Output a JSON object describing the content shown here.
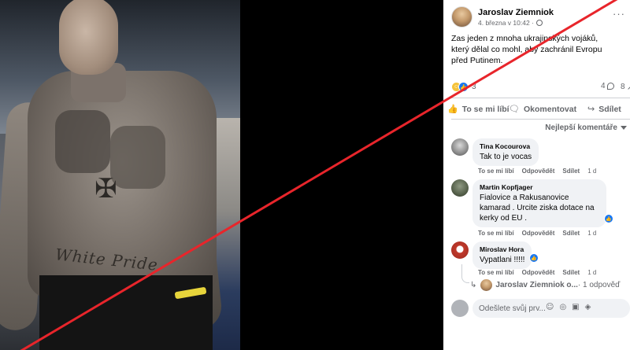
{
  "post": {
    "author": "Jaroslav Ziemniok",
    "date": "4. března v 10:42 ·",
    "text": "Zas jeden z mnoha ukrajinských vojáků, který dělal co mohl, aby zachránil Evropu před Putinem.",
    "reactions_count": "3",
    "comments_count": "4",
    "shares_count": "8"
  },
  "photo": {
    "tattoo_text": "White Pride"
  },
  "actions": {
    "like": "To se mi líbí",
    "comment": "Okomentovat",
    "share": "Sdílet"
  },
  "sort_label": "Nejlepší komentáře",
  "comments": [
    {
      "name": "Tina Kocourova",
      "text": "Tak to je vocas",
      "like": "To se mi líbí",
      "reply": "Odpovědět",
      "share": "Sdílet",
      "time": "1 d"
    },
    {
      "name": "Martin Kopfjager",
      "text": "Fialovice a Rakusanovice kamarad . Urcite ziska dotace na kerky od EU .",
      "like": "To se mi líbí",
      "reply": "Odpovědět",
      "share": "Sdílet",
      "time": "1 d"
    },
    {
      "name": "Miroslav Hora",
      "text": "Vypatlani !!!!!",
      "like": "To se mi líbí",
      "reply": "Odpovědět",
      "share": "Sdílet",
      "time": "1 d"
    }
  ],
  "reply_preview": {
    "name": "Jaroslav Ziemniok o...",
    "suffix": " · 1 odpověď"
  },
  "composer": {
    "placeholder": "Odešlete svůj prv..."
  },
  "colors": {
    "accent": "#1877f2",
    "slash": "#e8252b"
  }
}
